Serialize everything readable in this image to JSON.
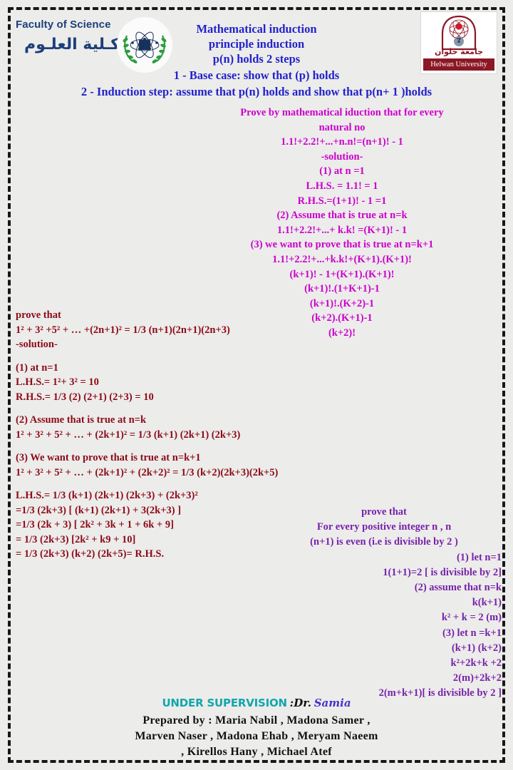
{
  "page": {
    "background_color": "#ececea",
    "border_color": "#17171a"
  },
  "header": {
    "faculty_en": "Faculty of Science",
    "faculty_ar": "كـلية العلـوم",
    "faculty_emblem_icon": "science-wreath-emblem-icon",
    "university_logo_icon": "helwan-university-logo-icon",
    "university_ar": "جامعة حلوان",
    "university_en": "Helwan University",
    "title_color": "#2222cc",
    "title_lines": [
      "Mathematical induction",
      "principle induction",
      "p(n) holds 2 steps"
    ],
    "step_lines": [
      "1  - Base case: show that (p) holds",
      "2  - Induction step: assume that p(n) holds and show that p(n+ 1 )holds"
    ]
  },
  "proof_factorial": {
    "color": "#cc00cc",
    "lines": [
      "Prove by mathematical iduction that for every",
      "natural no",
      "1.1!+2.2!+...+n.n!=(n+1)! - 1",
      "-solution-",
      "(1) at n =1",
      "L.H.S. = 1.1! = 1",
      "R.H.S.=(1+1)! - 1 =1",
      "(2) Assume that is true at n=k",
      "1.1!+2.2!+...+ k.k! =(K+1)! - 1",
      "(3) we want to prove that is true at n=k+1",
      "1.1!+2.2!+...+k.k!+(K+1).(K+1)!",
      "(k+1)! - 1+(K+1).(K+1)!",
      "(k+1)!.(1+K+1)-1",
      "(k+1)!.(K+2)-1",
      "(k+2).(K+1)-1",
      "(k+2)!"
    ]
  },
  "proof_odd_squares": {
    "color": "#8c0a18",
    "lines": [
      "prove that",
      "1² + 3² +5² + … +(2n+1)²  = 1/3 (n+1)(2n+1)(2n+3)",
      "-solution-",
      "",
      "(1)  at n=1",
      "L.H.S.= 1²+ 3² = 10",
      "R.H.S.= 1/3 (2) (2+1) (2+3) = 10",
      "",
      "(2) Assume that is true at n=k",
      "1² + 3² + 5² + … + (2k+1)² = 1/3 (k+1) (2k+1) (2k+3)",
      "",
      "(3) We want to prove that is true at n=k+1",
      "1² + 3² + 5² + … + (2k+1)² + (2k+2)² = 1/3 (k+2)(2k+3)(2k+5)",
      "",
      "L.H.S.= 1/3 (k+1) (2k+1) (2k+3) + (2k+3)²",
      "=1/3 (2k+3) [ (k+1) (2k+1) + 3(2k+3) ]",
      "=1/3 (2k + 3) [ 2k² + 3k + 1 + 6k + 9]",
      "= 1/3 (2k+3) [2k² + k9 + 10]",
      "=  1/3 (2k+3) (k+2) (2k+5)= R.H.S."
    ]
  },
  "proof_even": {
    "color": "#7722aa",
    "lines": [
      "prove that",
      "For every positive integer n , n",
      "(n+1) is even (i.e is divisible by 2  )",
      "(1)  let  n=1",
      "1(1+1)=2 [ is divisible by 2]",
      "(2) assume that n=k",
      "k(k+1)",
      "k² + k  = 2 (m)",
      "(3)  let  n  =k+1",
      "(k+1) (k+2)",
      "k²+2k+k  +2",
      "2(m)+2k+2",
      "2(m+k+1)[ is divisible by 2  ]"
    ]
  },
  "footer": {
    "supervision_label": "UNDER SUPERVISION",
    "supervision_colon": ":Dr.",
    "supervision_name": "Samia",
    "supervision_label_color": "#11a6ad",
    "supervision_name_color": "#4433cc",
    "prepared_lines": [
      "Prepared by : Maria Nabil , Madona Samer ,",
      "Marven Naser , Madona Ehab , Meryam Naeem",
      ", Kirellos Hany , Michael Atef"
    ]
  }
}
